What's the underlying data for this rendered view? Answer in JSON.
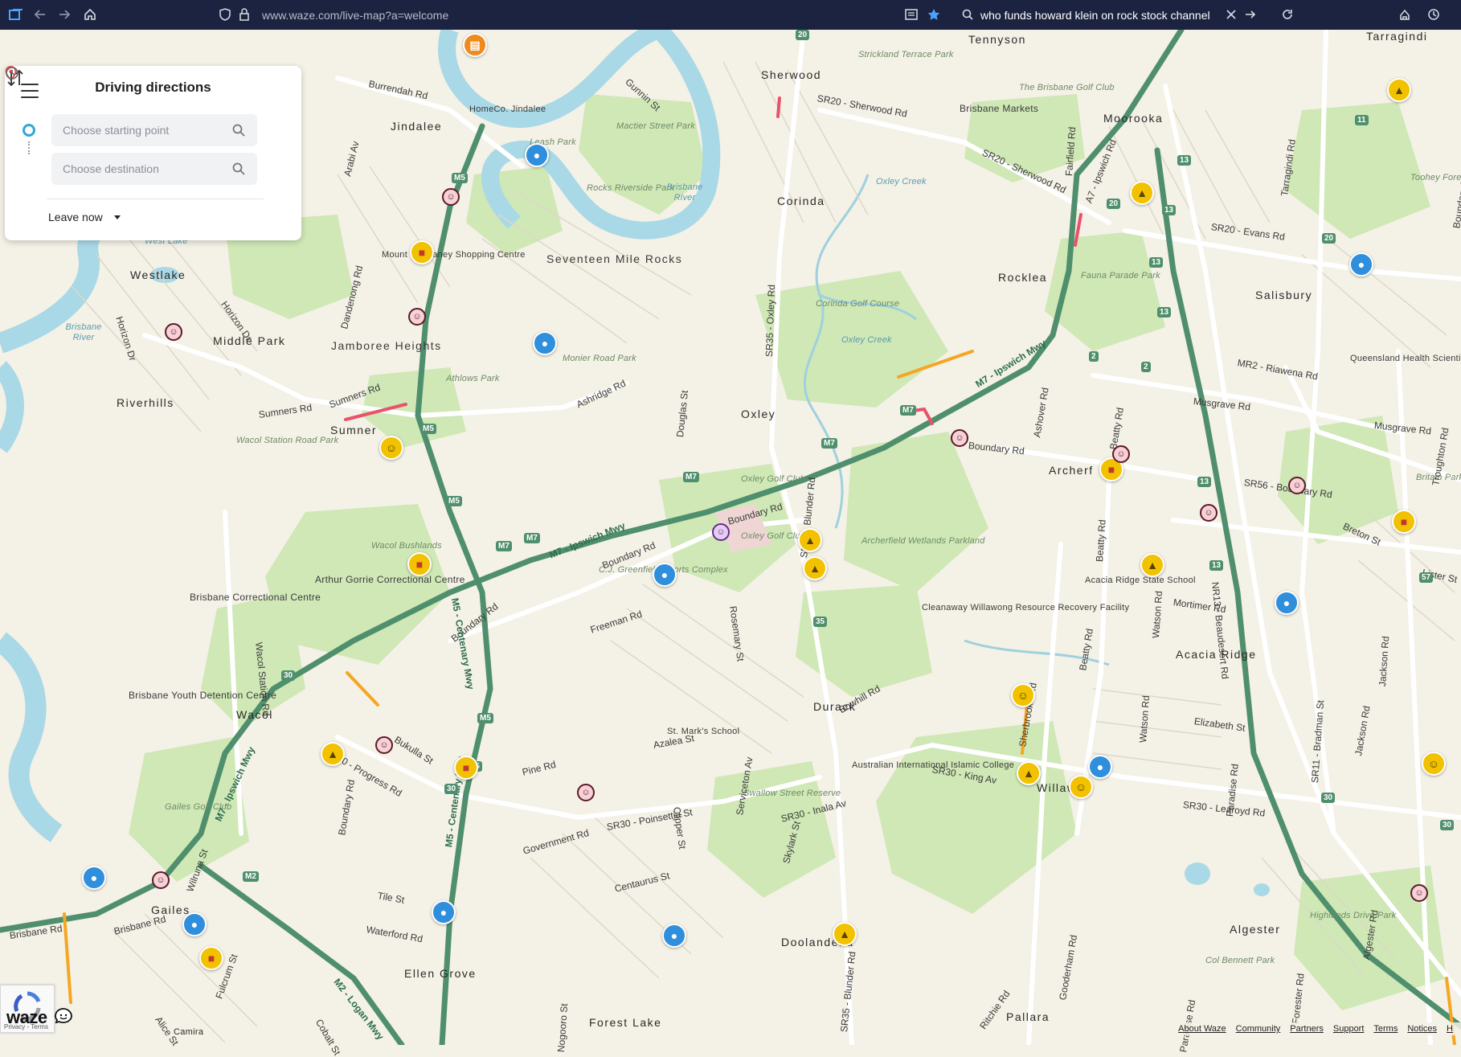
{
  "browser": {
    "url": "www.waze.com/live-map?a=welcome",
    "search_query": "who funds howard klein on rock stock channel"
  },
  "panel": {
    "title": "Driving directions",
    "start_placeholder": "Choose starting point",
    "destination_placeholder": "Choose destination",
    "leave_label": "Leave now"
  },
  "map": {
    "places": {
      "tennyson": "Tennyson",
      "sherwood": "Sherwood",
      "moorooka": "Moorooka",
      "jindalee": "Jindalee",
      "corinda": "Corinda",
      "seventeen_mile_rocks": "Seventeen Mile Rocks",
      "westlake": "Westlake",
      "rocklea": "Rocklea",
      "salisbury": "Salisbury",
      "middle_park": "Middle Park",
      "jamboree_heights": "Jamboree Heights",
      "riverhills": "Riverhills",
      "oxley": "Oxley",
      "sumner": "Sumner",
      "archerfield": "Archerf",
      "acacia_ridge": "Acacia Ridge",
      "durack": "Durack",
      "wacol": "Wacol",
      "willawong": "Willaw",
      "gailes": "Gailes",
      "ellen_grove": "Ellen Grove",
      "doolandella": "Doolandella",
      "algester": "Algester",
      "forest_lake": "Forest Lake",
      "pallara": "Pallara",
      "camira": "Camira",
      "tarragindi": "Tarragindi"
    },
    "pois": {
      "homeco": "HomeCo. Jindalee",
      "brisbane_markets": "Brisbane Markets",
      "mt_ommaney": "Mount Ommaney Shopping Centre",
      "qld_health": "Queensland Health Scientific Services",
      "brisbane_correctional": "Brisbane Correctional Centre",
      "arthur_gorrie": "Arthur Gorrie Correctional Centre",
      "brisbane_youth": "Brisbane Youth Detention Centre",
      "acacia_ridge_school": "Acacia Ridge State School",
      "cleanaway": "Cleanaway Willawong Resource Recovery Facility",
      "st_marks": "St. Mark's School",
      "australian_islamic": "Australian International Islamic College"
    },
    "parks": {
      "mactier": "Mactier Street Park",
      "brisbane_golf": "The Brisbane Golf Club",
      "strickland": "Strickland Terrace Park",
      "rocks_riverside": "Rocks Riverside Park",
      "corinda_golf": "Corinda Golf Course",
      "fauna_parade": "Fauna Parade Park",
      "monier_road": "Monier Road Park",
      "oxley_golf": "Oxley Golf Club",
      "archerfield_wetlands": "Archerfield Wetlands Parkland",
      "cj_greenfield": "C.J. Greenfield Sports Complex",
      "wacol_bushlands": "Wacol Bushlands",
      "wacol_station": "Wacol Station Road Park",
      "athlows": "Athlows Park",
      "gailes_golf": "Gailes Golf Club",
      "swallow_street": "Swallow Street Reserve",
      "highlands_drive": "Highlands Drive Park",
      "col_bennett": "Col Bennett Park",
      "toohey_forest": "Toohey Forest Park",
      "britain_park": "Britain Park",
      "leash_park": "Leash Park"
    },
    "water": {
      "brisbane_river": "Brisbane River",
      "brisbane_river_w": "Brisbane River",
      "oxley_creek": "Oxley Creek",
      "oxley_creek_2": "Oxley Creek",
      "west_lake": "West Lake"
    },
    "roads": {
      "burrendah": "Burrendah Rd",
      "gunnin": "Gunnin St",
      "sr20_sherwood": "SR20 - Sherwood Rd",
      "sr20_sherwood_2": "SR20 - Sherwood Rd",
      "sr20_evans": "SR20 - Evans Rd",
      "a7_ipswich": "A7 - Ipswich Rd",
      "fairfield": "Fairfield Rd",
      "arabi": "Arabi Av",
      "horizon": "Horizon Dr",
      "horizon_2": "Horizon Dr",
      "dandenong": "Dandenong Rd",
      "sr35_oxley": "SR35 - Oxley Rd",
      "m7_ipswich_e": "M7 - Ipswich Mwy",
      "m7_ipswich_c": "M7 - Ipswich Mwy",
      "m7_ipswich_sw": "M7 - Ipswich Mwy",
      "mr2_riawena": "MR2 - Riawena Rd",
      "musgrave": "Musgrave Rd",
      "musgrave_2": "Musgrave Rd",
      "sumners": "Sumners Rd",
      "sumners_2": "Sumners Rd",
      "ashridge": "Ashridge Rd",
      "douglas": "Douglas St",
      "boundary_e": "Boundary Rd",
      "boundary_c": "Boundary Rd",
      "boundary_c2": "Boundary Rd",
      "boundary_w": "Boundary Rd",
      "boundary_s": "Boundary Rd",
      "ashover": "Ashover Rd",
      "beatty": "Beatty Rd",
      "beatty_2": "Beatty Rd",
      "beatty_3": "Beatty Rd",
      "sr56": "SR56 - Boundary Rd",
      "breton": "Breton St",
      "lister": "Lister St",
      "m5_centenary": "M5 - Centenary Mwy",
      "m5_centenary_s": "M5 - Centenary Hwy",
      "sr35_blunder": "SR35 - Blunder Rd",
      "sr35_blunder_s": "SR35 - Blunder Rd",
      "freeman": "Freeman Rd",
      "rosemary": "Rosemary St",
      "mortimer": "Mortimer Rd",
      "nr13_beaudesert": "NR13 - Beaudesert Rd",
      "watson": "Watson Rd",
      "watson_2": "Watson Rd",
      "elizabeth": "Elizabeth St",
      "bowhill": "Bowhill Rd",
      "azalea": "Azalea St",
      "sr30_progress": "SR30 - Progress Rd",
      "bukulla": "Bukulla St",
      "pine": "Pine Rd",
      "sr30_king": "SR30 - King Av",
      "sr30_learoyd": "SR30 - Learoyd Rd",
      "sr30_inala": "SR30 - Inala Av",
      "sr30_poinsettia": "SR30 - Poinsettia St",
      "government": "Government Rd",
      "serviceton": "Serviceton Av",
      "clipper": "Clipper St",
      "skylark": "Skylark St",
      "centaurus": "Centaurus St",
      "m7_ipswich_w": "M7 - Ipswich Mwy",
      "wilruna": "Wilruna St",
      "tile": "Tile St",
      "waterford": "Waterford Rd",
      "m2_logan": "M2 - Logan Mwy",
      "brisbane_rd": "Brisbane Rd",
      "brisbane_rd_2": "Brisbane Rd",
      "alice": "Alice St",
      "cobalt": "Cobalt St",
      "fulcrum": "Fulcrum St",
      "nogooro": "Nogooro St",
      "gooderham": "Gooderham Rd",
      "ritchie": "Ritchie Rd",
      "paradise": "Paradise Rd",
      "paradise_2": "Paradise Rd",
      "sr11_bradman": "SR11 - Bradman St",
      "jackson": "Jackson Rd",
      "jackson_2": "Jackson Rd",
      "algester_rd": "Algester Rd",
      "forester": "Forester Rd",
      "wacol_station_rd": "Wacol Station Rd",
      "tarragindi_rd": "Tarragindi Rd",
      "troughton": "Troughton Rd",
      "boundary_rd_n": "Boundary Rd",
      "unknown_sr": "Sherbrooke Rd"
    },
    "shields": [
      "20",
      "20",
      "20",
      "11",
      "13",
      "13",
      "13",
      "13",
      "13",
      "13",
      "M5",
      "M5",
      "M5",
      "M5",
      "M5",
      "M7",
      "M7",
      "M7",
      "M7",
      "M7",
      "2",
      "2",
      "35",
      "30",
      "30",
      "30",
      "30",
      "57",
      "M2"
    ]
  },
  "markers": {
    "police": [
      "police-icon"
    ],
    "hazard": [
      "hazard-icon"
    ],
    "traffic": [
      "traffic-jam-icon"
    ],
    "closure": [
      "road-closure-icon"
    ],
    "camera": [
      "speed-camera-icon"
    ]
  },
  "footer": {
    "brand": "waze",
    "recaptcha": "Privacy - Terms",
    "links": [
      "About Waze",
      "Community",
      "Partners",
      "Support",
      "Terms",
      "Notices",
      "H"
    ]
  },
  "colors": {
    "land": "#f4f1e6",
    "park": "#cfe8b6",
    "water": "#a9d8e6",
    "motorway": "#4f8f6d",
    "major_road": "#ffffff",
    "browser_bar": "#1c2340",
    "police_marker": "#2f8fdc",
    "hazard_marker": "#f2c200",
    "closure_marker": "#f08a1c",
    "heavy_traffic": "#e8526a",
    "slow_traffic": "#f5a623"
  }
}
